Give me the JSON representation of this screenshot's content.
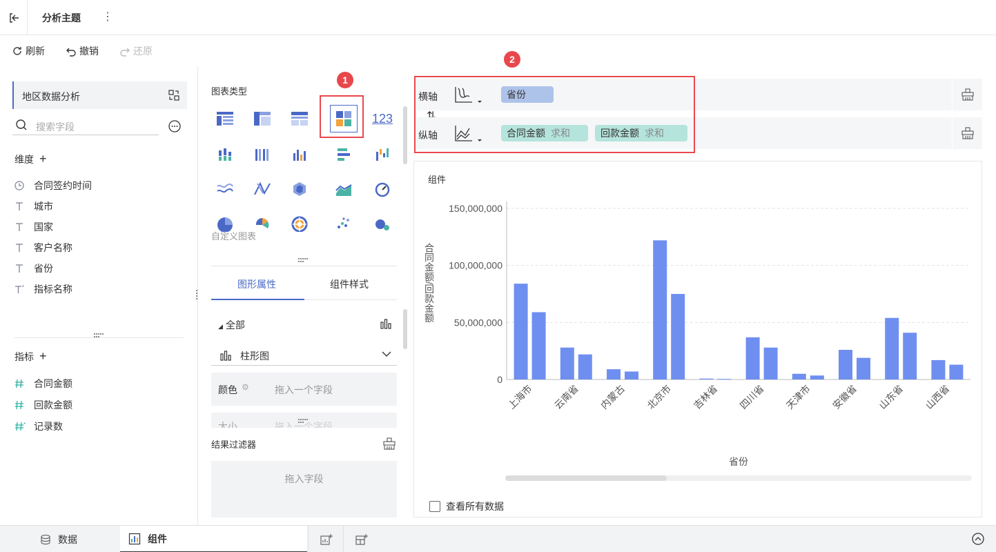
{
  "header": {
    "title": "分析主题"
  },
  "toolbar": {
    "refresh": "刷新",
    "undo": "撤销",
    "redo": "还原"
  },
  "left": {
    "dataset": "地区数据分析",
    "search_placeholder": "搜索字段",
    "dimensions_title": "维度",
    "dimensions": [
      {
        "label": "合同签约时间",
        "icon": "clock-icon"
      },
      {
        "label": "城市",
        "icon": "text-type-icon"
      },
      {
        "label": "国家",
        "icon": "text-type-icon"
      },
      {
        "label": "客户名称",
        "icon": "text-type-icon"
      },
      {
        "label": "省份",
        "icon": "text-type-icon"
      },
      {
        "label": "指标名称",
        "icon": "text-type-star-icon"
      }
    ],
    "measures_title": "指标",
    "measures": [
      {
        "label": "合同金额",
        "icon": "hash-icon"
      },
      {
        "label": "回款金额",
        "icon": "hash-icon"
      },
      {
        "label": "记录数",
        "icon": "hash-star-icon"
      }
    ]
  },
  "middle": {
    "chart_type_title": "图表类型",
    "number_chart_label": "123",
    "custom_chart": "自定义图表",
    "tabs": [
      "图形属性",
      "组件样式"
    ],
    "all_label": "全部",
    "chart_select": "柱形图",
    "color_label": "颜色",
    "drop_placeholder": "拖入一个字段",
    "size_label": "大小",
    "filter_title": "结果过滤器",
    "filter_placeholder": "拖入字段"
  },
  "axes": {
    "x_label": "横轴",
    "y_label": "纵轴",
    "x_fields": [
      {
        "name": "省份"
      }
    ],
    "y_fields": [
      {
        "name": "合同金额",
        "agg": "求和"
      },
      {
        "name": "回款金额",
        "agg": "求和"
      }
    ]
  },
  "annotations": {
    "badge1": "1",
    "badge2": "2"
  },
  "component": {
    "name": "组件",
    "view_all": "查看所有数据"
  },
  "bottom": {
    "data_tab": "数据",
    "component_tab": "组件"
  },
  "colors": {
    "accent": "#4a69c6",
    "bar": "#6f8ff0",
    "dim_pill": "#aec3ea",
    "measure_pill": "#b5e4dc",
    "highlight": "#e8474c"
  },
  "chart_data": {
    "type": "bar",
    "categories": [
      "上海市",
      "云南省",
      "内蒙古",
      "北京市",
      "吉林省",
      "四川省",
      "天津市",
      "安徽省",
      "山东省",
      "山西省"
    ],
    "series": [
      {
        "name": "合同金额",
        "values": [
          84000000,
          28000000,
          9000000,
          122000000,
          800000,
          37000000,
          5000000,
          26000000,
          54000000,
          17000000
        ]
      },
      {
        "name": "回款金额",
        "values": [
          59000000,
          22000000,
          7000000,
          75000000,
          500000,
          28000000,
          3500000,
          19000000,
          41000000,
          13000000
        ]
      }
    ],
    "xlabel": "省份",
    "ylabel": "合同金额/回款金额",
    "ylim": [
      0,
      150000000
    ],
    "yticks": [
      0,
      50000000,
      100000000,
      150000000
    ],
    "ytick_labels": [
      "0",
      "50,000,000",
      "100,000,000",
      "150,000,000"
    ],
    "grid": true
  }
}
